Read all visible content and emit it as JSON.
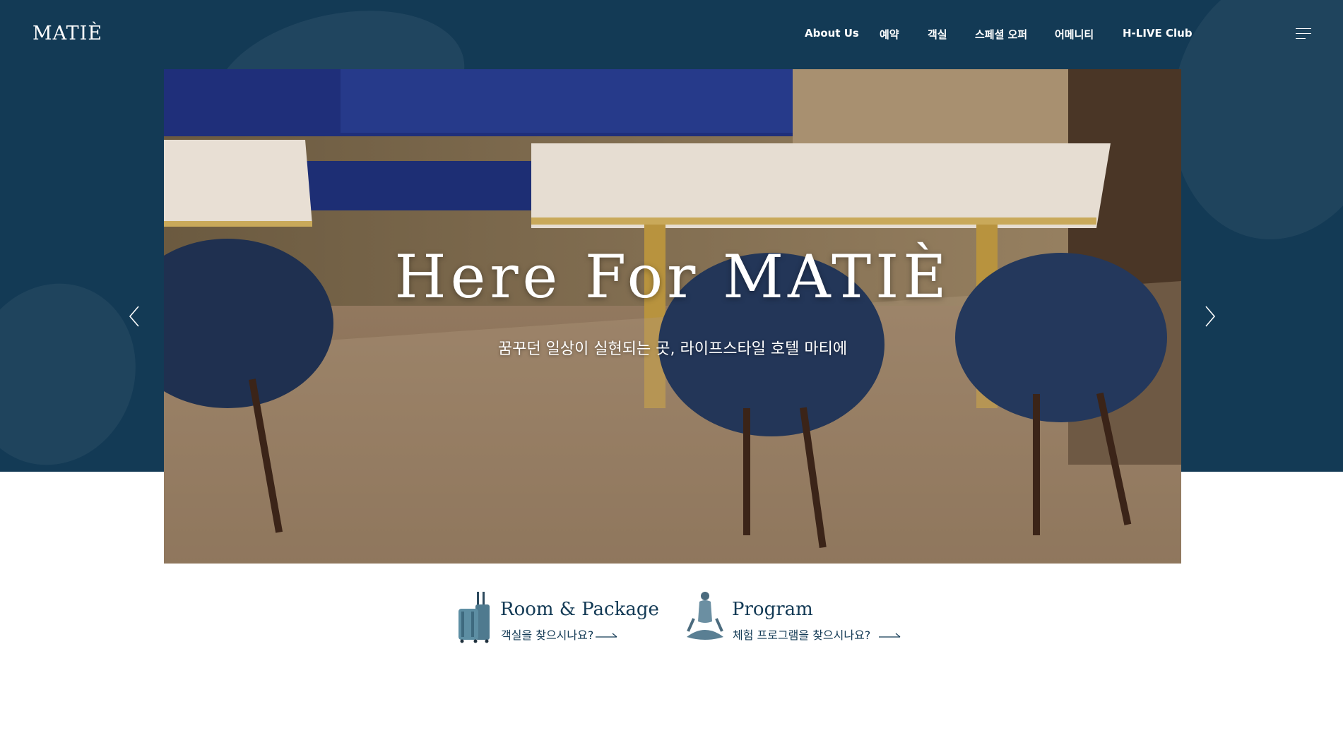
{
  "header": {
    "logo": "MATIÈ",
    "nav": [
      "About Us",
      "예약",
      "객실",
      "스페셜 오퍼",
      "어메니티",
      "H-LIVE Club"
    ],
    "menu_icon": "hamburger-menu-icon"
  },
  "hero": {
    "title": "Here For MATIÈ",
    "subtitle": "꿈꾸던 일상이 실현되는 곳, 라이프스타일 호텔 마티에",
    "prev_icon": "chevron-left-icon",
    "next_icon": "chevron-right-icon"
  },
  "links": [
    {
      "title": "Room & Package",
      "desc": "객실을 찾으시나요?",
      "icon": "luggage-icon"
    },
    {
      "title": "Program",
      "desc": "체험 프로그램을 찾으시나요?",
      "icon": "meditation-figure-icon"
    }
  ],
  "colors": {
    "navy": "#133a55",
    "white": "#ffffff"
  }
}
